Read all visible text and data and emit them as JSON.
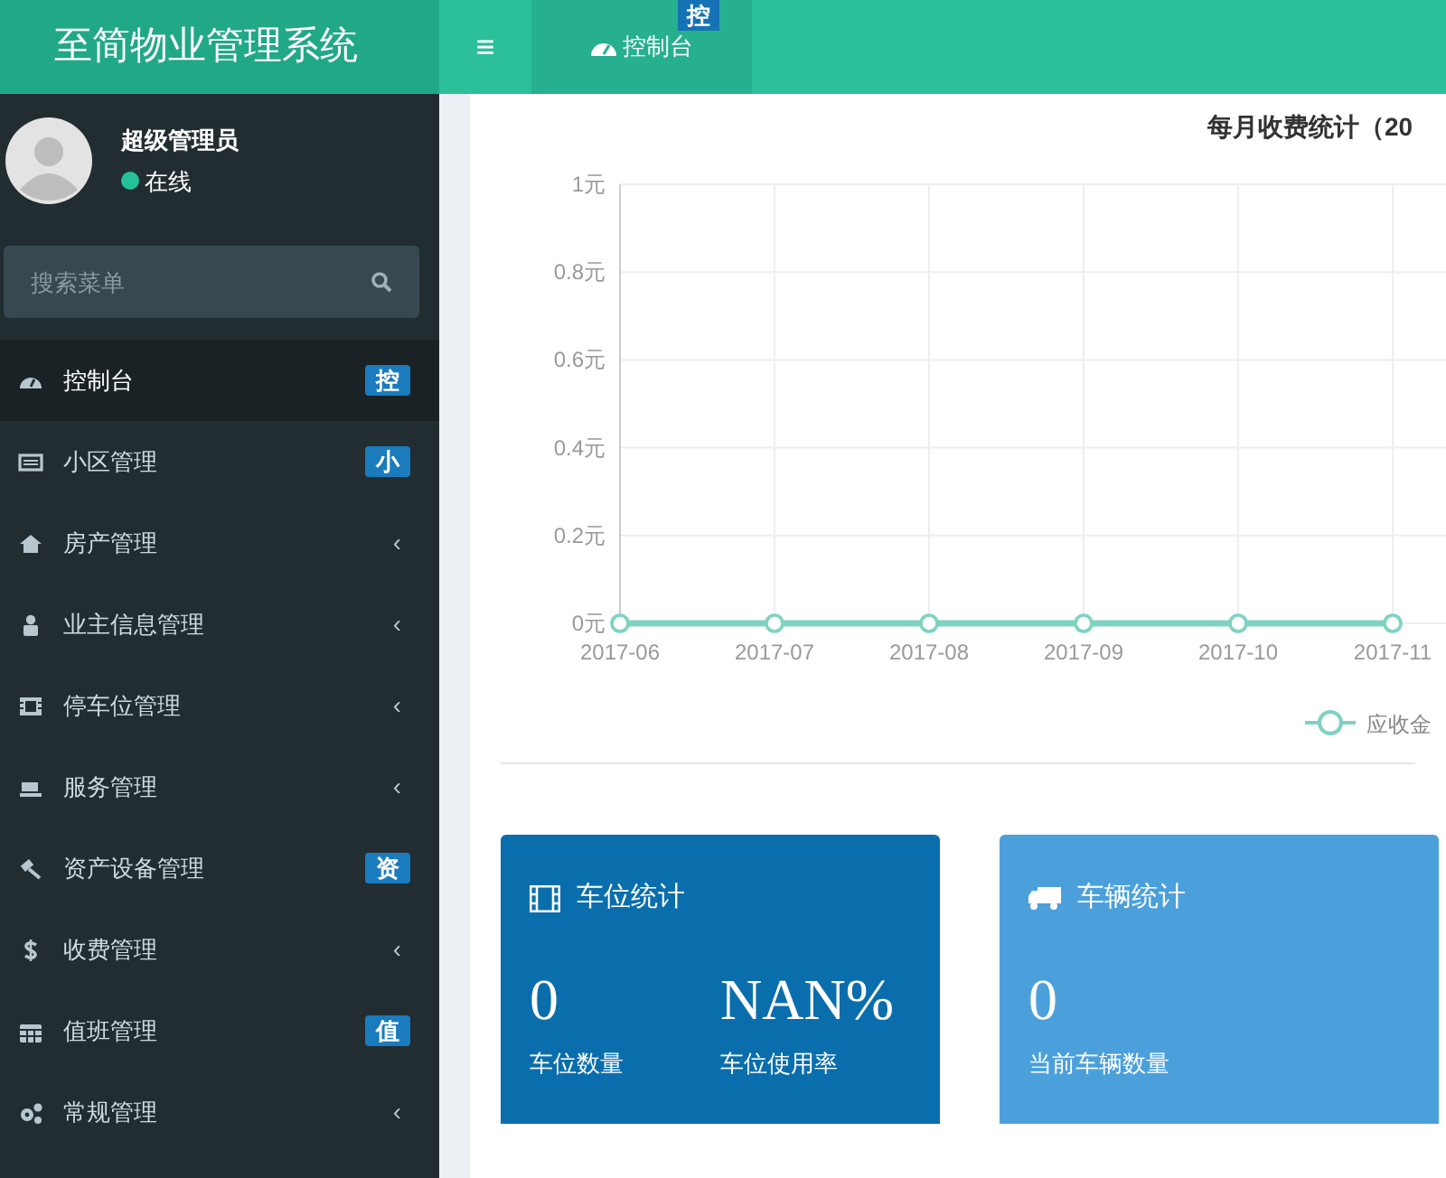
{
  "header": {
    "title": "至简物业管理系统",
    "menu_toggle": "≡",
    "tabs": [
      {
        "label": "控制台",
        "badge": "控",
        "selected": true
      }
    ]
  },
  "user": {
    "name": "超级管理员",
    "status": "在线",
    "online": true
  },
  "search": {
    "placeholder": "搜索菜单"
  },
  "sidebar": {
    "items": [
      {
        "label": "控制台",
        "selected": true,
        "badge": "控"
      },
      {
        "label": "小区管理",
        "selected": false,
        "badge": "小"
      },
      {
        "label": "房产管理",
        "selected": false,
        "arrow": "‹"
      },
      {
        "label": "业主信息管理",
        "selected": false,
        "arrow": "‹"
      },
      {
        "label": "停车位管理",
        "selected": false,
        "arrow": "‹"
      },
      {
        "label": "服务管理",
        "selected": false,
        "arrow": "‹"
      },
      {
        "label": "资产设备管理",
        "selected": false,
        "badge": "资"
      },
      {
        "label": "收费管理",
        "selected": false,
        "arrow": "‹"
      },
      {
        "label": "值班管理",
        "selected": false,
        "badge": "值"
      },
      {
        "label": "常规管理",
        "selected": false,
        "arrow": "‹"
      }
    ]
  },
  "chart": {
    "title": "每月收费统计（20",
    "chart_data": {
      "type": "line",
      "categories": [
        "2017-06",
        "2017-07",
        "2017-08",
        "2017-09",
        "2017-10",
        "2017-11"
      ],
      "series": [
        {
          "name": "应收金",
          "color": "#7fd2c1",
          "marker": "circle",
          "values": [
            0,
            0,
            0,
            0,
            0,
            0
          ]
        }
      ],
      "grid": true,
      "ylim": [
        0,
        1
      ],
      "yticks": [
        {
          "value": 0,
          "label": "0元"
        },
        {
          "value": 0.2,
          "label": "0.2元"
        },
        {
          "value": 0.4,
          "label": "0.4元"
        },
        {
          "value": 0.6,
          "label": "0.6元"
        },
        {
          "value": 0.8,
          "label": "0.8元"
        },
        {
          "value": 1,
          "label": "1元"
        }
      ]
    }
  },
  "cards": [
    {
      "title": "车位统计",
      "color": "#0b6eac",
      "stats": [
        {
          "value": "0",
          "label": "车位数量"
        },
        {
          "value": "NAN%",
          "label": "车位使用率"
        }
      ]
    },
    {
      "title": "车辆统计",
      "color": "#4ba0dc",
      "stats": [
        {
          "value": "0",
          "label": "当前车辆数量"
        }
      ]
    }
  ]
}
